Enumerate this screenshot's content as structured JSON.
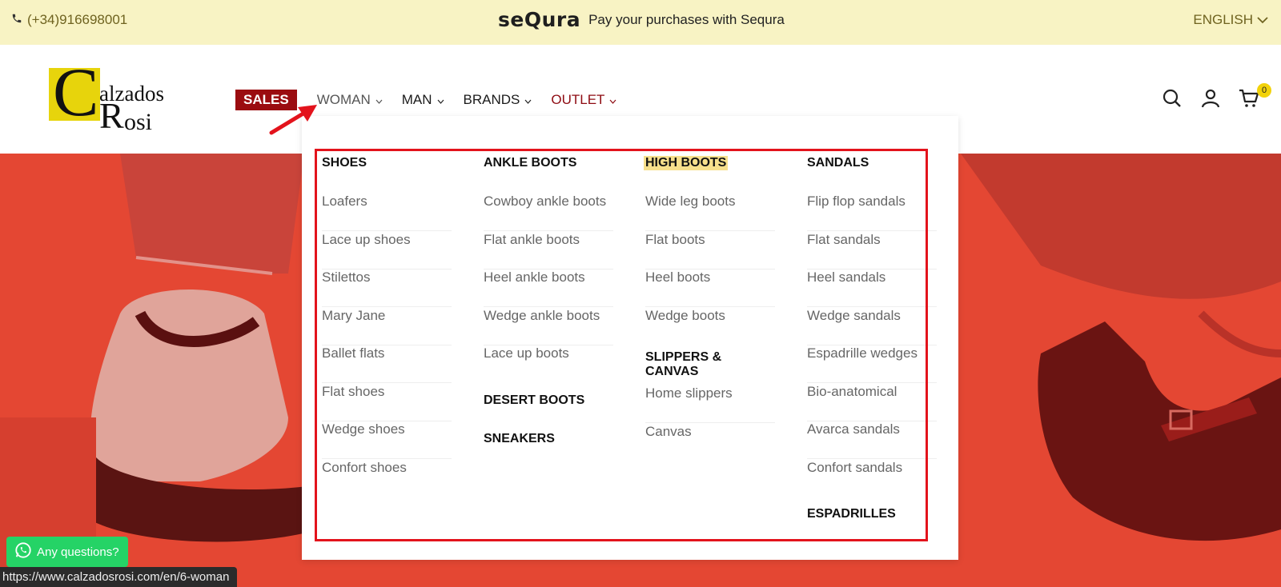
{
  "topbar": {
    "phone": "(+34)916698001",
    "brand": "seQura",
    "promo_text": "Pay your purchases with Sequra",
    "language": "ENGLISH"
  },
  "header": {
    "logo_text_1": "alzados",
    "logo_text_2": "osi",
    "logo_letter_1": "C",
    "logo_letter_2": "R",
    "nav": {
      "sales": "SALES",
      "woman": "WOMAN",
      "man": "MAN",
      "brands": "BRANDS",
      "outlet": "OUTLET"
    },
    "cart_count": "0"
  },
  "mega_menu": {
    "columns": [
      {
        "title": "SHOES",
        "items": [
          "Loafers",
          "Lace up shoes",
          "Stilettos",
          "Mary Jane",
          "Ballet flats",
          "Flat shoes",
          "Wedge shoes",
          "Confort shoes"
        ]
      },
      {
        "title": "ANKLE BOOTS",
        "items": [
          "Cowboy ankle boots",
          "Flat ankle boots",
          "Heel ankle boots",
          "Wedge ankle boots",
          "Lace up boots"
        ],
        "extra_titles": [
          "DESERT BOOTS",
          "SNEAKERS"
        ]
      },
      {
        "title": "HIGH BOOTS",
        "items": [
          "Wide leg boots",
          "Flat boots",
          "Heel boots",
          "Wedge boots"
        ],
        "section2_title": "SLIPPERS & CANVAS",
        "section2_items": [
          "Home slippers",
          "Canvas"
        ]
      },
      {
        "title": "SANDALS",
        "items": [
          "Flip flop sandals",
          "Flat sandals",
          "Heel sandals",
          "Wedge sandals",
          "Espadrille wedges",
          "Bio-anatomical",
          "Avarca sandals",
          "Confort sandals"
        ],
        "extra_titles": [
          "ESPADRILLES"
        ]
      }
    ]
  },
  "whatsapp_label": "Any questions?",
  "status_url": "https://www.calzadosrosi.com/en/6-woman",
  "colors": {
    "topbar_bg": "#f8f3c4",
    "sales_bg": "#9b0c10",
    "outlet": "#8e0b12",
    "hero_bg": "#e44733",
    "highlight": "#f7e08c",
    "frame": "#e3131c",
    "whatsapp": "#25d366"
  }
}
